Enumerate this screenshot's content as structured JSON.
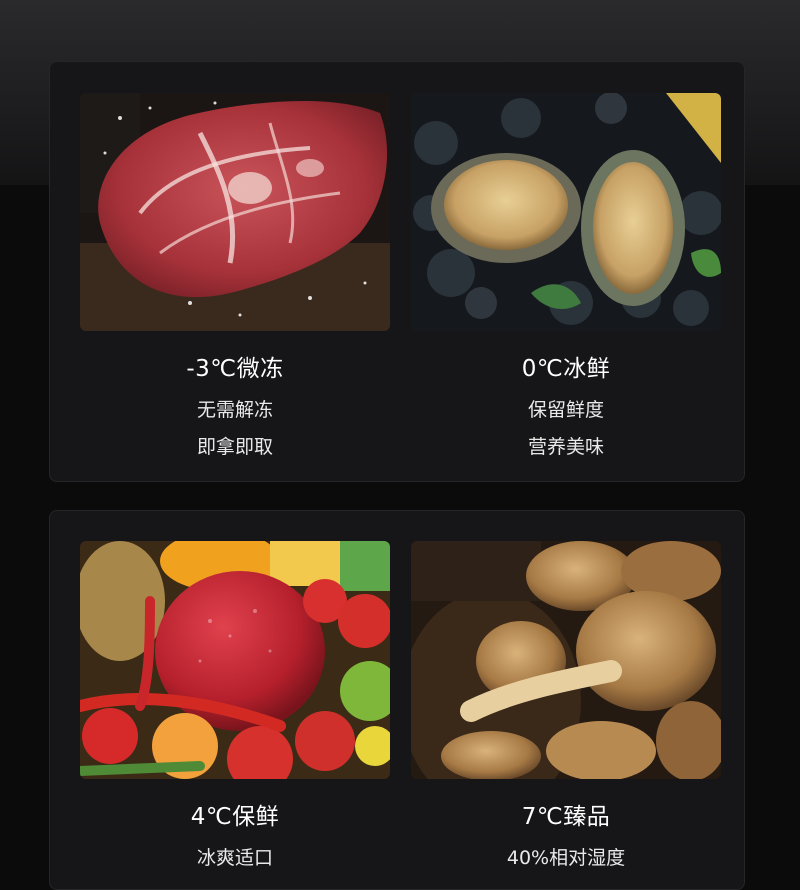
{
  "cards": [
    {
      "title": "-3℃微冻",
      "line1": "无需解冻",
      "line2": "即拿即取",
      "photo": "frozen-steak"
    },
    {
      "title": "0℃冰鲜",
      "line1": "保留鲜度",
      "line2": "营养美味",
      "photo": "abalone-on-ice"
    },
    {
      "title": "4℃保鲜",
      "line1": "冰爽适口",
      "photo": "fresh-fruits-vegetables"
    },
    {
      "title": "7℃臻品",
      "line1": "40%相对湿度",
      "photo": "dried-mushrooms"
    }
  ]
}
